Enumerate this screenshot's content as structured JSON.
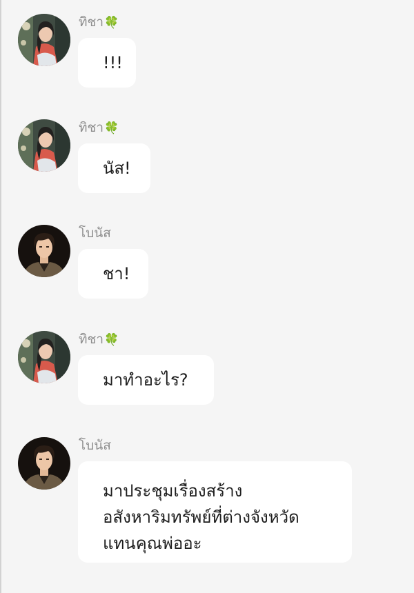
{
  "messages": [
    {
      "sender": "ทิชา",
      "sender_badge": "🍀",
      "avatar": "avatar-ticha",
      "text": "!!!"
    },
    {
      "sender": "ทิชา",
      "sender_badge": "🍀",
      "avatar": "avatar-ticha",
      "text": "นัส!"
    },
    {
      "sender": "โบนัส",
      "avatar": "avatar-bonus",
      "text": "ชา!"
    },
    {
      "sender": "ทิชา",
      "sender_badge": "🍀",
      "avatar": "avatar-ticha",
      "text": "มาทำอะไร?"
    },
    {
      "sender": "โบนัส",
      "avatar": "avatar-bonus",
      "lines": [
        "มาประชุมเรื่องสร้าง",
        "อสังหาริมทรัพย์ที่ต่างจังหวัด",
        "แทนคุณพ่ออะ"
      ]
    }
  ],
  "colors": {
    "background": "#f5f5f5",
    "bubble": "#ffffff",
    "sender_name": "#8e8e8e",
    "text": "#1d1d1d",
    "clover": "#3f9a37"
  }
}
